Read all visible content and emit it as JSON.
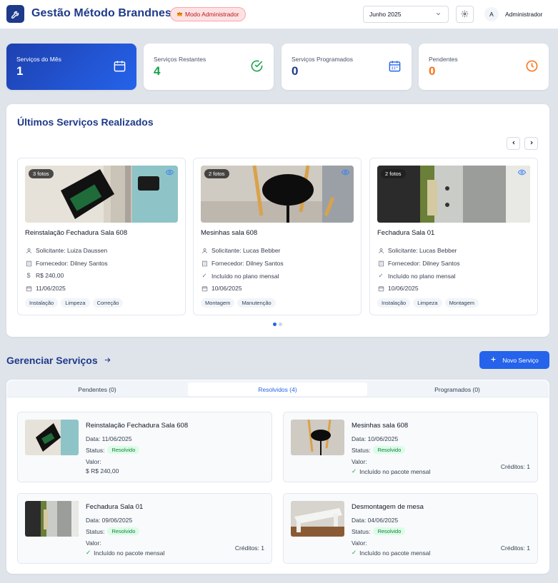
{
  "header": {
    "title": "Gestão Método Brandness",
    "admin_badge": "Modo Administrador",
    "month": "Junho 2025",
    "avatar_initial": "A",
    "user_name": "Administrador"
  },
  "stats": [
    {
      "label": "Serviços do Mês",
      "value": "1",
      "icon": "calendar-icon",
      "color": "#ffffff"
    },
    {
      "label": "Serviços Restantes",
      "value": "4",
      "icon": "check-circle-icon",
      "color": "#16a34a"
    },
    {
      "label": "Serviços Programados",
      "value": "0",
      "icon": "calendar-grid-icon",
      "color": "#1e3a8a"
    },
    {
      "label": "Pendentes",
      "value": "0",
      "icon": "clock-icon",
      "color": "#f97316"
    }
  ],
  "recent": {
    "title": "Últimos Serviços Realizados",
    "cards": [
      {
        "badge": "3 fotos",
        "title": "Reinstalação Fechadura Sala 608",
        "requester": "Solicitante: Luiza Daussen",
        "supplier": "Fornecedor: Dilney Santos",
        "cost": "R$ 240,00",
        "date": "11/06/2025",
        "tags": [
          "Instalação",
          "Limpeza",
          "Correção"
        ]
      },
      {
        "badge": "2 fotos",
        "title": "Mesinhas sala 608",
        "requester": "Solicitante: Lucas Bebber",
        "supplier": "Fornecedor: Dilney Santos",
        "cost": "Incluído no plano mensal",
        "date": "10/06/2025",
        "tags": [
          "Montagem",
          "Manutenção"
        ]
      },
      {
        "badge": "2 fotos",
        "title": "Fechadura Sala 01",
        "requester": "Solicitante: Lucas Bebber",
        "supplier": "Fornecedor: Dilney Santos",
        "cost": "Incluído no plano mensal",
        "date": "10/06/2025",
        "tags": [
          "Instalação",
          "Limpeza",
          "Montagem"
        ]
      }
    ]
  },
  "manage": {
    "title": "Gerenciar Serviços",
    "new_button": "Novo Serviço",
    "tabs": [
      "Pendentes (0)",
      "Resolvidos (4)",
      "Programados (0)"
    ],
    "resolved": [
      {
        "title": "Reinstalação Fechadura Sala 608",
        "date": "Data: 11/06/2025",
        "status_label": "Status:",
        "status": "Resolvido",
        "value_label": "Valor:",
        "value": "$ R$ 240,00",
        "credits": ""
      },
      {
        "title": "Mesinhas sala 608",
        "date": "Data: 10/06/2025",
        "status_label": "Status:",
        "status": "Resolvido",
        "value_label": "Valor:",
        "value": "Incluído no pacote mensal",
        "credits": "Créditos: 1"
      },
      {
        "title": "Fechadura Sala 01",
        "date": "Data: 09/06/2025",
        "status_label": "Status:",
        "status": "Resolvido",
        "value_label": "Valor:",
        "value": "Incluído no pacote mensal",
        "credits": "Créditos: 1"
      },
      {
        "title": "Desmontagem de mesa",
        "date": "Data: 04/06/2025",
        "status_label": "Status:",
        "status": "Resolvido",
        "value_label": "Valor:",
        "value": "Incluído no pacote mensal",
        "credits": "Créditos: 1"
      }
    ]
  },
  "colors": {
    "brand": "#1e3a8a",
    "accent": "#2563eb",
    "success": "#16a34a",
    "warning": "#f97316"
  }
}
